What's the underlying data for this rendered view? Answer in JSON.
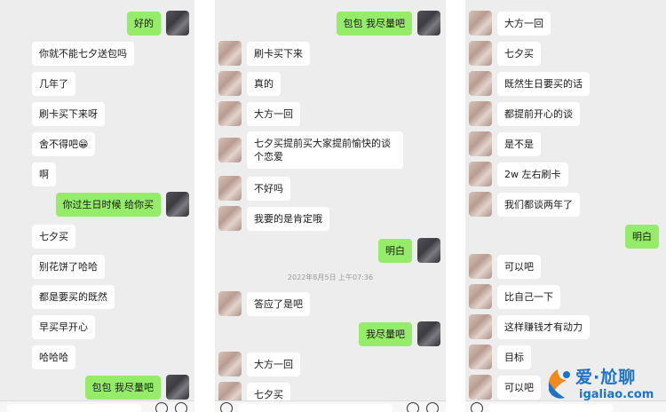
{
  "panel1": {
    "messages": [
      {
        "text": "好的"
      },
      {
        "text": "你就不能七夕送包吗"
      },
      {
        "text": "几年了"
      },
      {
        "text": "刷卡买下来呀"
      },
      {
        "text": "舍不得吧",
        "emoji": "😁"
      },
      {
        "text": "啊"
      },
      {
        "text": "你过生日时候 给你买"
      },
      {
        "text": "七夕买"
      },
      {
        "text": "别花饼了哈哈"
      },
      {
        "text": "都是要买的既然"
      },
      {
        "text": "早买早开心"
      },
      {
        "text": "哈哈哈"
      },
      {
        "text": "包包 我尽量吧"
      }
    ]
  },
  "panel2": {
    "messages": [
      {
        "text": "包包 我尽量吧"
      },
      {
        "text": "刷卡买下来"
      },
      {
        "text": "真的"
      },
      {
        "text": "大方一回"
      },
      {
        "text": "七夕买提前买大家提前愉快的谈个恋爱"
      },
      {
        "text": "不好吗"
      },
      {
        "text": "我要的是肯定哦"
      },
      {
        "text": "明白"
      },
      {
        "text": "答应了是吧"
      },
      {
        "text": "我尽量吧"
      },
      {
        "text": "大方一回"
      },
      {
        "text": "七夕买"
      }
    ],
    "timestamp": "2022年8月5日 上午07:36"
  },
  "panel3": {
    "messages": [
      {
        "text": "大方一回"
      },
      {
        "text": "七夕买"
      },
      {
        "text": "既然生日要买的话"
      },
      {
        "text": "都提前开心的谈"
      },
      {
        "text": "是不是"
      },
      {
        "text": "2w 左右刷卡"
      },
      {
        "text": "我们都谈两年了"
      },
      {
        "text": "明白"
      },
      {
        "text": "可以吧"
      },
      {
        "text": "比自己一下"
      },
      {
        "text": "这样赚钱才有动力"
      },
      {
        "text": "目标"
      },
      {
        "text": "可以吧"
      }
    ]
  },
  "watermark": {
    "title": "爱·尬聊",
    "url": "igaliao.com",
    "color": "#1f72c6"
  },
  "colors": {
    "background": "#ededed",
    "bubble_sent": "#95ec69",
    "bubble_received": "#ffffff"
  },
  "icons": [
    "voice-icon",
    "emoji-icon",
    "plus-icon"
  ]
}
